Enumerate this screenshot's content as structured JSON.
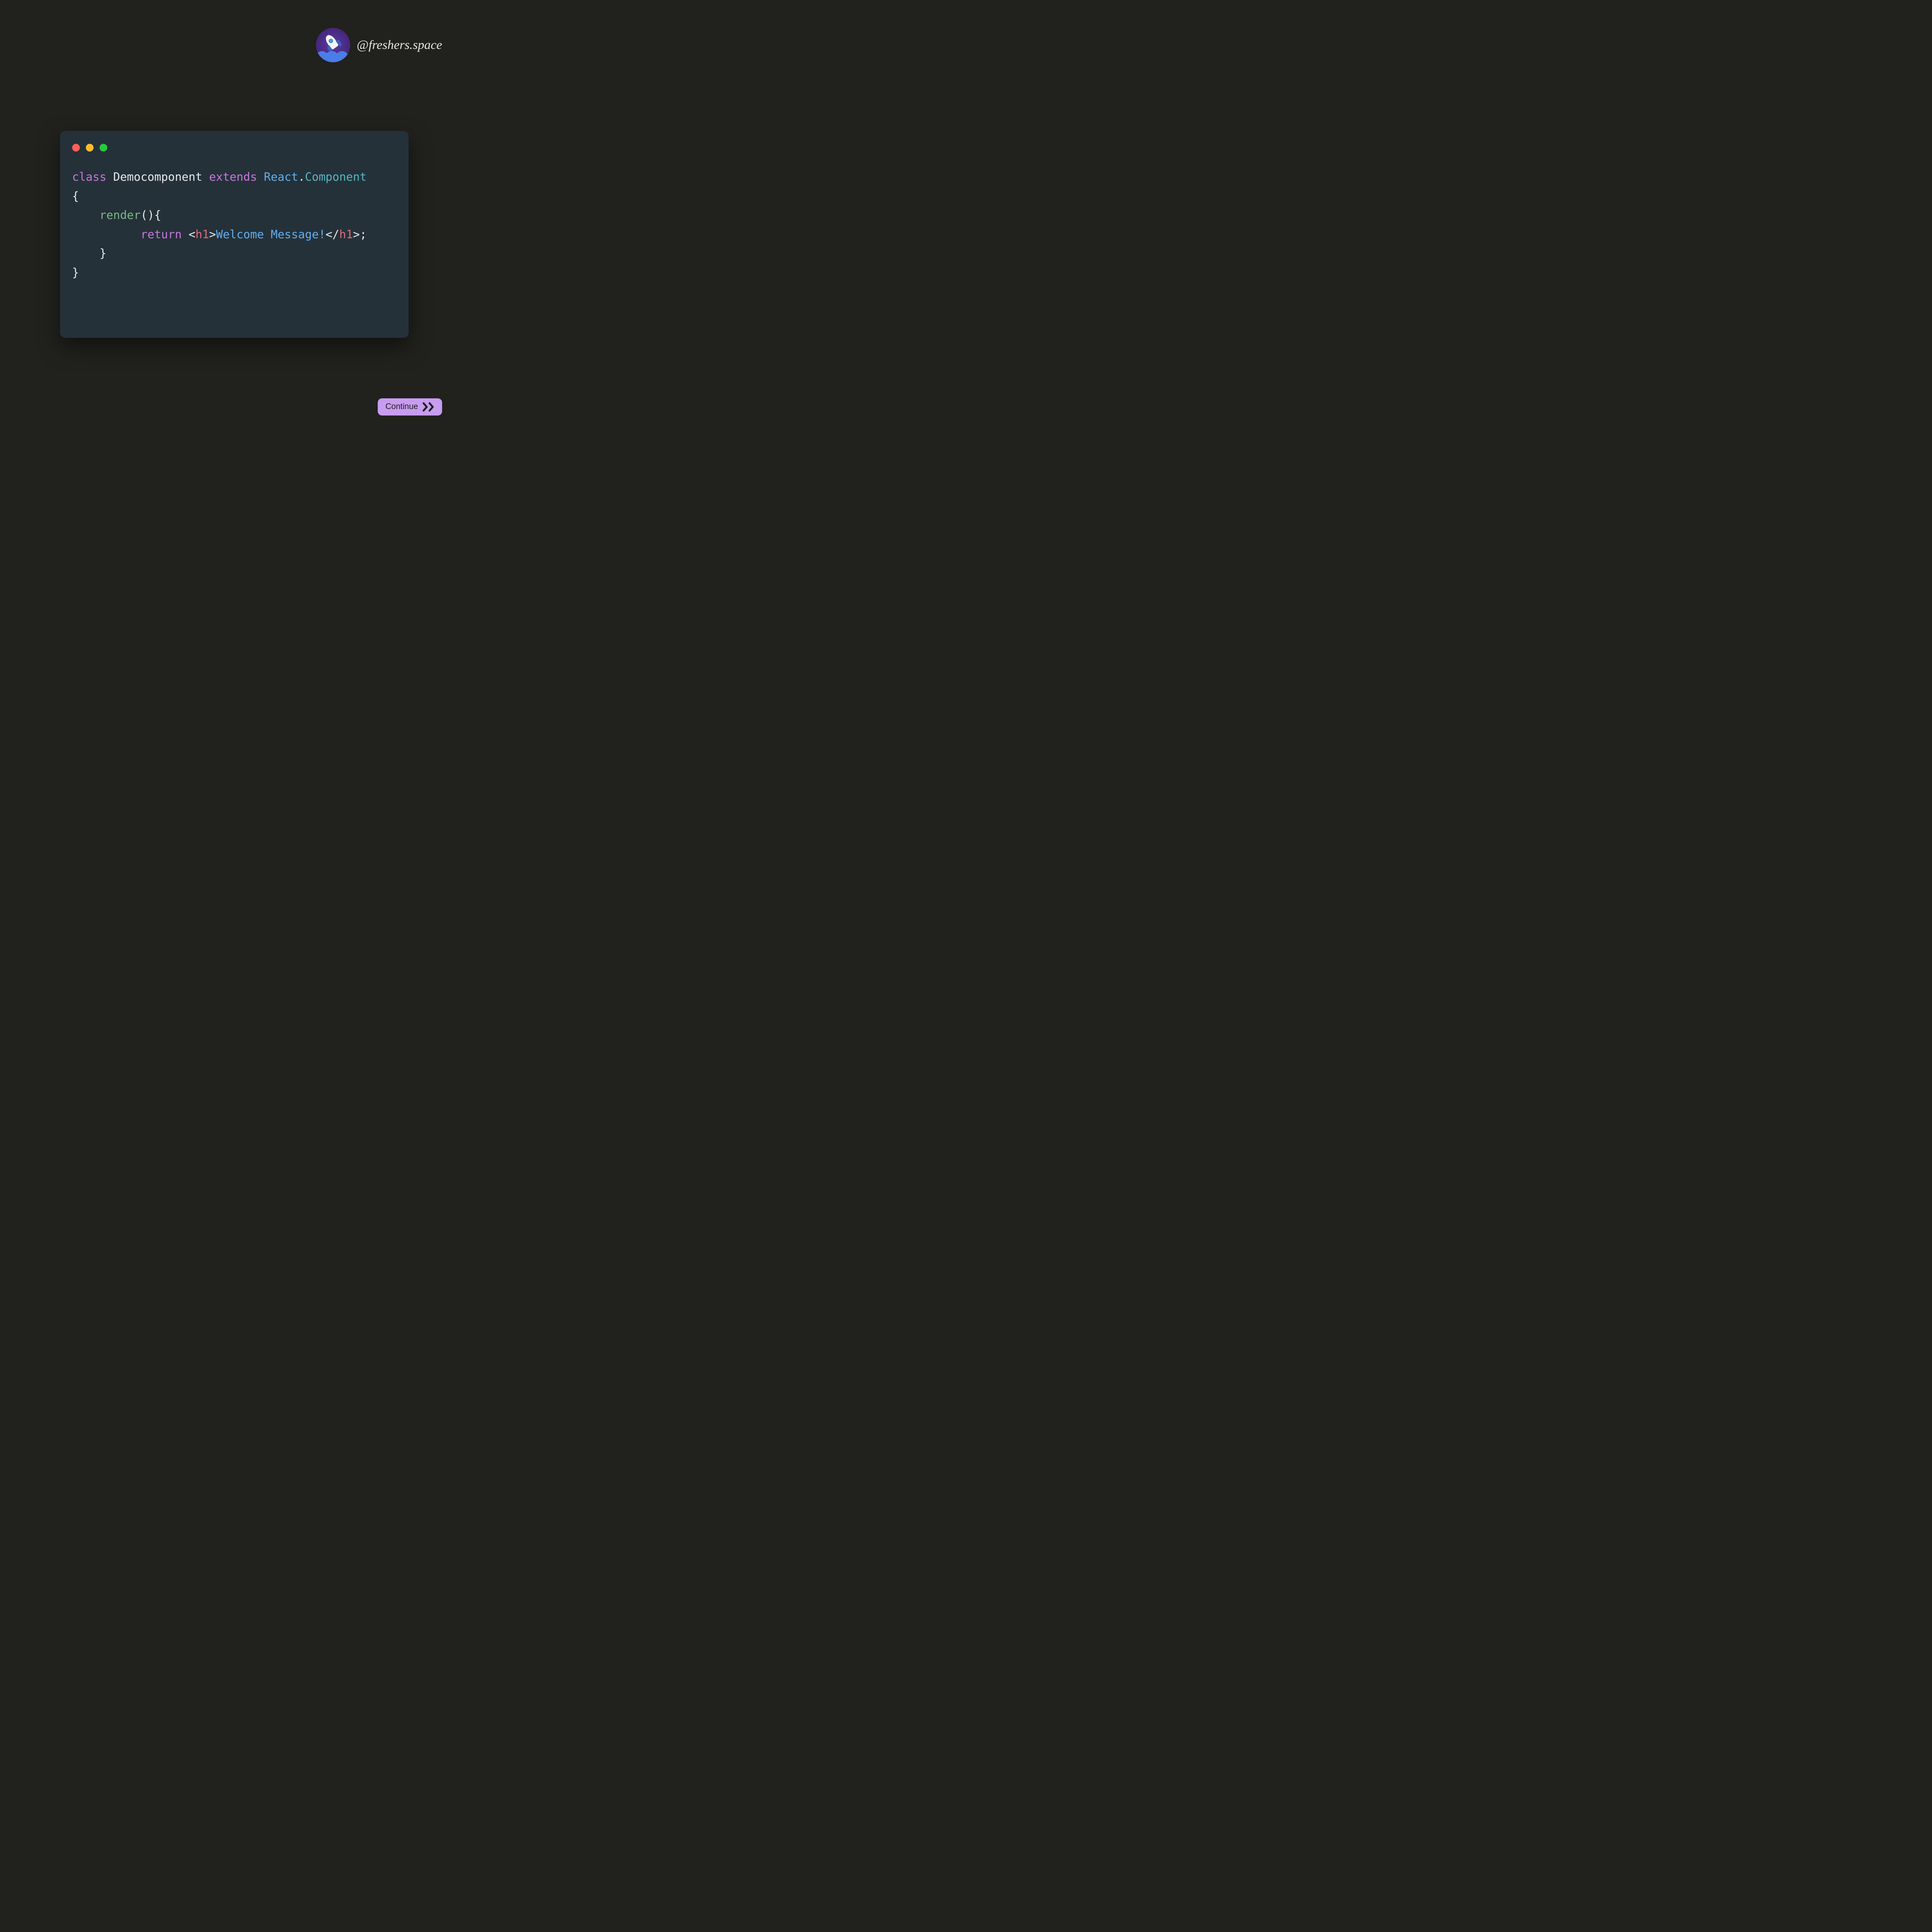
{
  "header": {
    "handle": "@freshers.space"
  },
  "code": {
    "line1": {
      "class_kw": "class",
      "class_name": "Democomponent",
      "extends_kw": "extends",
      "react": "React",
      "dot": ".",
      "component": "Component"
    },
    "line2": "{",
    "line3": {
      "indent": "    ",
      "render": "render",
      "parens_brace": "(){"
    },
    "line4": {
      "indent": "          ",
      "return_kw": "return",
      "tag_open_lt": "<",
      "tag_open_name": "h1",
      "tag_open_gt": ">",
      "text": "Welcome Message!",
      "tag_close_lt": "</",
      "tag_close_name": "h1",
      "tag_close_gt": ">",
      "semicolon": ";"
    },
    "line5": {
      "indent": "    ",
      "brace": "}"
    },
    "line6": "}"
  },
  "cta": {
    "continue_label": "Continue"
  }
}
